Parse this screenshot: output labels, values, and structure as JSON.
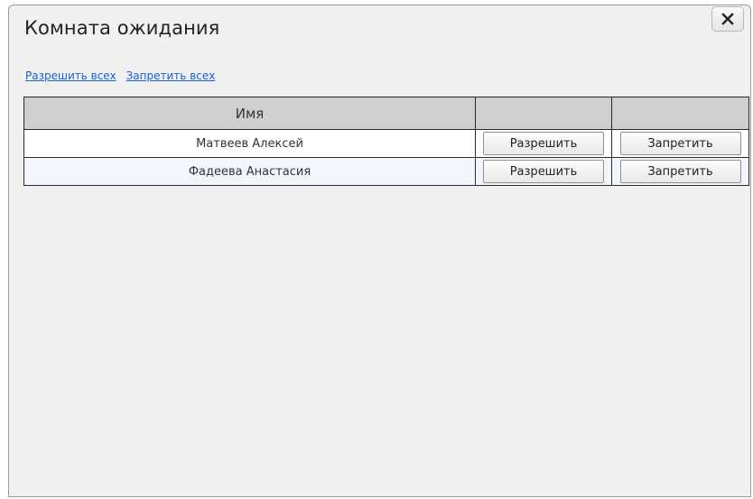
{
  "dialog": {
    "title": "Комната ожидания",
    "close_icon": "close-icon"
  },
  "actions": {
    "allow_all": "Разрешить всех",
    "deny_all": "Запретить всех"
  },
  "table": {
    "columns": [
      "Имя",
      "",
      ""
    ],
    "rows": [
      {
        "name": "Матвеев Алексей",
        "allow": "Разрешить",
        "deny": "Запретить"
      },
      {
        "name": "Фадеева Анастасия",
        "allow": "Разрешить",
        "deny": "Запретить"
      }
    ]
  },
  "colors": {
    "dialog_background": "#f0f0f0",
    "link": "#1a5fd8",
    "header_background": "#cfcfcf",
    "row_alt_background": "#f2f6fc"
  }
}
